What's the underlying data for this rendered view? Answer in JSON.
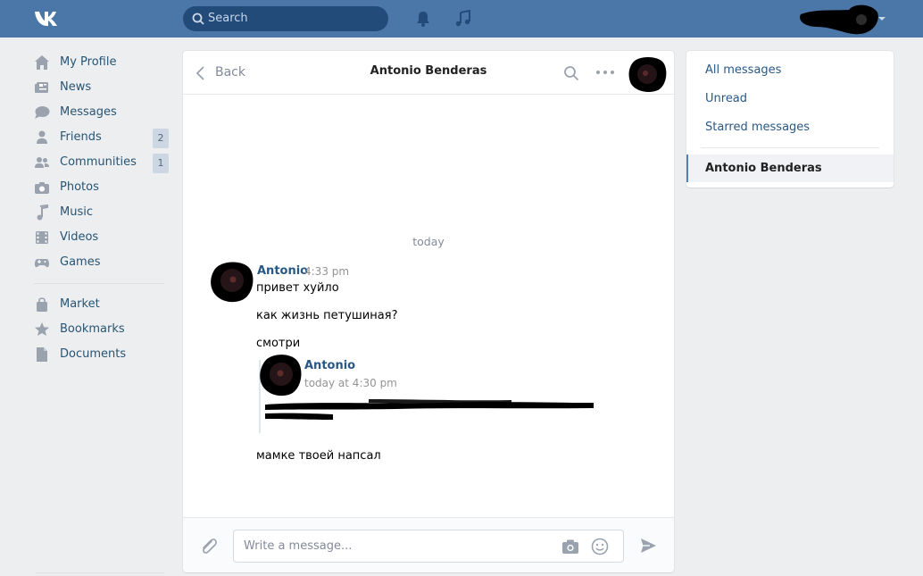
{
  "topbar": {
    "logo": "VK",
    "search_placeholder": "Search",
    "icons": [
      "bell-icon",
      "music-note-icon"
    ],
    "colors": {
      "bar": "#4a76a8",
      "search_bg": "#224b7a"
    }
  },
  "sidebar": {
    "items": [
      {
        "label": "My Profile",
        "icon": "home-icon"
      },
      {
        "label": "News",
        "icon": "newspaper-icon"
      },
      {
        "label": "Messages",
        "icon": "chat-bubble-icon"
      },
      {
        "label": "Friends",
        "icon": "person-icon",
        "badge": "2"
      },
      {
        "label": "Communities",
        "icon": "people-icon",
        "badge": "1"
      },
      {
        "label": "Photos",
        "icon": "camera-icon"
      },
      {
        "label": "Music",
        "icon": "music-note-icon"
      },
      {
        "label": "Videos",
        "icon": "film-icon"
      },
      {
        "label": "Games",
        "icon": "gamepad-icon"
      }
    ],
    "items2": [
      {
        "label": "Market",
        "icon": "bag-icon"
      },
      {
        "label": "Bookmarks",
        "icon": "star-icon"
      },
      {
        "label": "Documents",
        "icon": "document-icon"
      }
    ]
  },
  "chat": {
    "back_label": "Back",
    "title": "Antonio Benderas",
    "date_separator": "today",
    "message": {
      "author": "Antonio",
      "time": "4:33 pm",
      "lines": [
        "привет хуйло",
        "как жизнь петушиная?",
        "смотри"
      ],
      "after_forward": "мамке твоей напсал"
    },
    "forwarded": {
      "author": "Antonio",
      "time": "today at 4:30 pm"
    },
    "composer_placeholder": "Write a message..."
  },
  "right_panel": {
    "items": [
      "All messages",
      "Unread",
      "Starred messages"
    ],
    "active": "Antonio Benderas",
    "accent": "#5181b8"
  }
}
